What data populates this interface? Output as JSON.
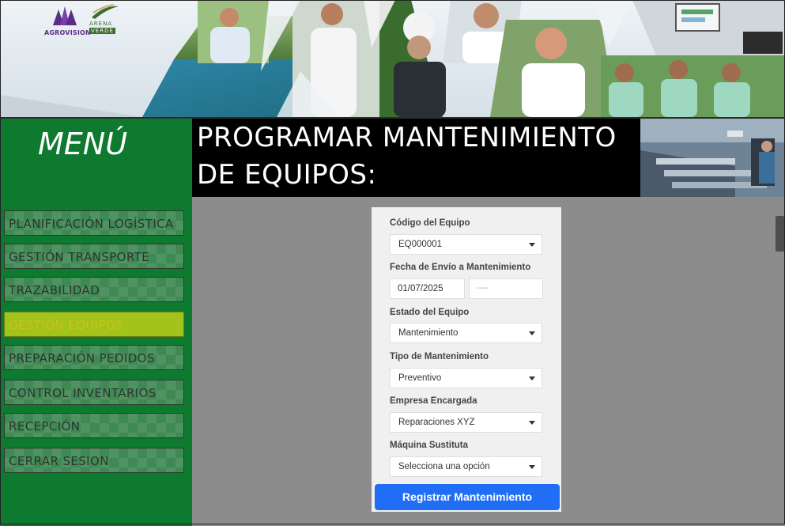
{
  "logos": {
    "agrovision": "AGROVISION",
    "arena_line1": "ARENA",
    "arena_line2": "VERDE"
  },
  "sidebar": {
    "title": "MENÚ",
    "items": [
      {
        "label": "PLANIFICACIÓN LOGÍSTICA"
      },
      {
        "label": "GESTIÓN TRANSPORTE"
      },
      {
        "label": "TRAZABILIDAD"
      },
      {
        "label": "GESTIÓN EQUIPOS",
        "active": true
      },
      {
        "label": "PREPARACIÓN PEDIDOS"
      },
      {
        "label": "CONTROL INVENTARIOS"
      },
      {
        "label": "RECEPCIÓN"
      },
      {
        "label": "CERRAR SESION"
      }
    ]
  },
  "header": {
    "title_line1": "PROGRAMAR MANTENIMIENTO",
    "title_line2": "DE EQUIPOS:"
  },
  "form": {
    "codigo_label": "Código del Equipo",
    "codigo_value": "EQ000001",
    "fecha_label": "Fecha de Envío a Mantenimiento",
    "fecha_value": "01/07/2025",
    "fecha2_placeholder": "----",
    "estado_label": "Estado del Equipo",
    "estado_value": "Mantenimiento",
    "tipo_label": "Tipo de Mantenimiento",
    "tipo_value": "Preventivo",
    "empresa_label": "Empresa Encargada",
    "empresa_value": "Reparaciones XYZ",
    "maquina_label": "Máquina Sustituta",
    "maquina_value": "Selecciona una opción",
    "submit_label": "Registrar Mantenimiento"
  },
  "colors": {
    "sidebar_bg": "#0d7a2f",
    "active_item": "#a3c21a",
    "primary_button": "#1f6ef5",
    "title_bg": "#000000"
  }
}
